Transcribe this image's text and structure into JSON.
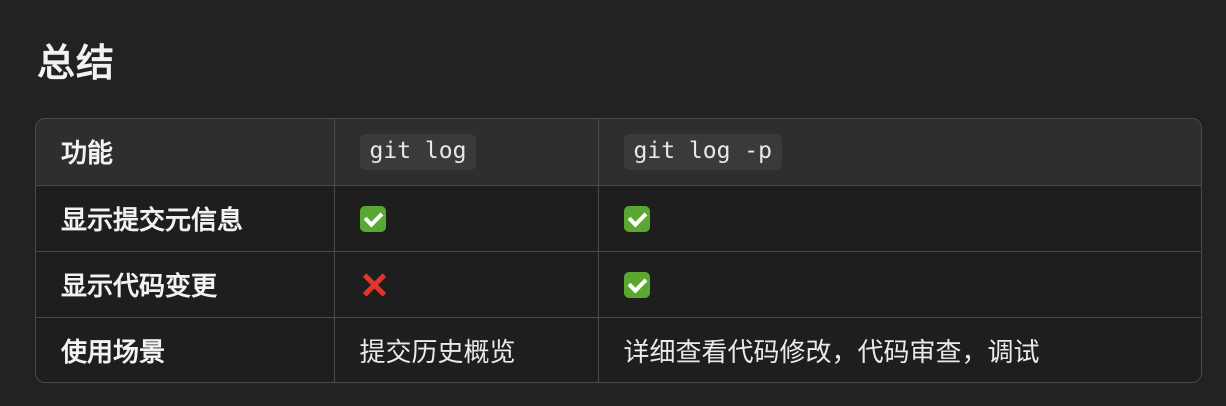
{
  "section": {
    "title": "总结"
  },
  "table": {
    "headers": [
      "功能",
      "git log",
      "git log -p"
    ],
    "rows": [
      {
        "feature": "显示提交元信息",
        "git_log": "check-icon",
        "git_log_p": "check-icon"
      },
      {
        "feature": "显示代码变更",
        "git_log": "cross-icon",
        "git_log_p": "check-icon"
      },
      {
        "feature": "使用场景",
        "git_log": "提交历史概览",
        "git_log_p": "详细查看代码修改，代码审查，调试"
      }
    ]
  },
  "colors": {
    "background": "#222222",
    "header_bg": "#2e2e2e",
    "check_green": "#5aa832",
    "cross_red": "#e0352b"
  }
}
